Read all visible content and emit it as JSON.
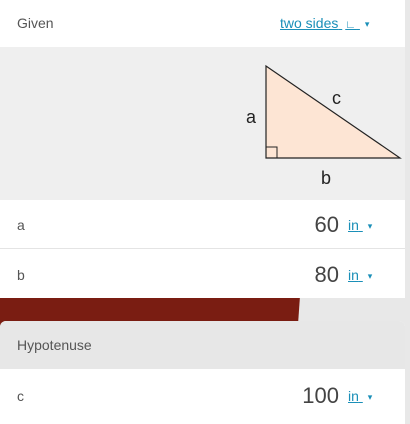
{
  "given": {
    "label": "Given",
    "mode": "two sides",
    "mode_icon": "∟",
    "caret": "▾"
  },
  "diagram": {
    "side_a": "a",
    "side_b": "b",
    "side_c": "c",
    "fill_color": "#fde5d4"
  },
  "inputs": [
    {
      "name": "a",
      "value": "60",
      "unit": "in"
    },
    {
      "name": "b",
      "value": "80",
      "unit": "in"
    }
  ],
  "hypotenuse": {
    "label": "Hypotenuse",
    "name": "c",
    "value": "100",
    "unit": "in"
  },
  "colors": {
    "link": "#1a8fb8",
    "backdrop": "#7a1d12"
  }
}
